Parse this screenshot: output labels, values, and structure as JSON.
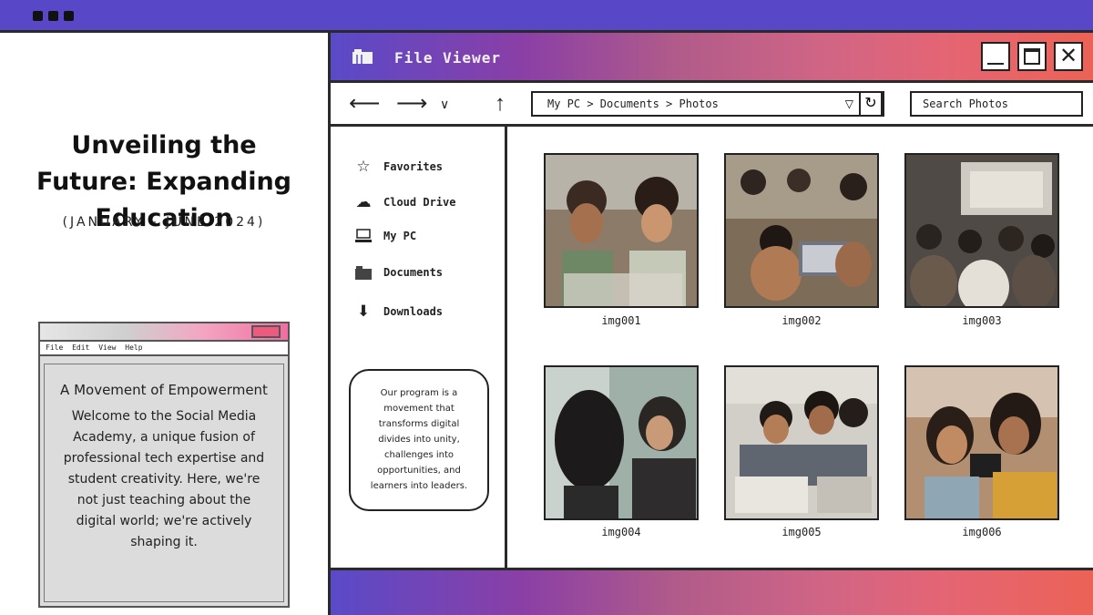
{
  "slide": {
    "title": "Unveiling the Future: Expanding Education",
    "date": "(JANUARY - JUNE 2024)"
  },
  "mini_window": {
    "menu": [
      "File",
      "Edit",
      "View",
      "Help"
    ],
    "heading": "A Movement of Empowerment",
    "body": "Welcome to the Social Media Academy, a unique fusion of professional tech expertise and student creativity. Here, we're not just teaching about the digital world; we're actively shaping it."
  },
  "file_viewer": {
    "title": "File Viewer",
    "path": "My PC > Documents > Photos",
    "search_placeholder": "Search Photos",
    "sidebar": [
      {
        "label": "Favorites",
        "icon": "star-icon"
      },
      {
        "label": "Cloud Drive",
        "icon": "cloud-icon"
      },
      {
        "label": "My PC",
        "icon": "computer-icon"
      },
      {
        "label": "Documents",
        "icon": "folder-icon"
      },
      {
        "label": "Downloads",
        "icon": "download-icon"
      }
    ],
    "quote": "Our program is a movement that transforms digital divides into unity, challenges into opportunities, and learners into leaders.",
    "files": [
      {
        "name": "img001"
      },
      {
        "name": "img002"
      },
      {
        "name": "img003"
      },
      {
        "name": "img004"
      },
      {
        "name": "img005"
      },
      {
        "name": "img006"
      }
    ]
  },
  "colors": {
    "accent": "#5847c6",
    "gradient_start": "#5a4ac8",
    "gradient_end": "#ec6255"
  }
}
